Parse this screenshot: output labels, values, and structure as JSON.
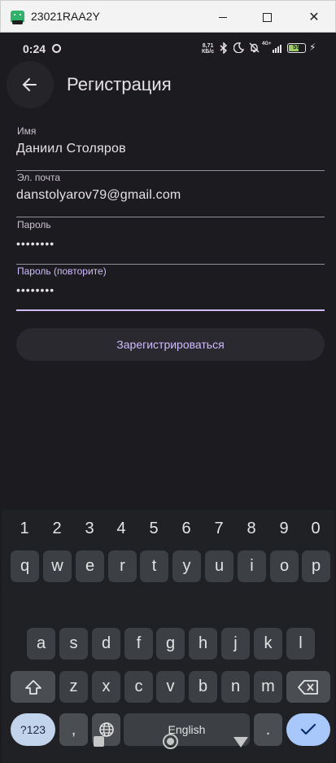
{
  "window": {
    "title": "23021RAA2Y",
    "close_glyph": "✕"
  },
  "status_bar": {
    "time": "0:24",
    "net_speed_value": "8,71",
    "net_speed_unit": "КБ/с",
    "network": "4G+",
    "battery": "59",
    "icons": [
      "bluetooth-icon",
      "moon-icon",
      "mute-icon",
      "signal-icon",
      "battery-icon",
      "charging-icon"
    ]
  },
  "app_bar": {
    "title": "Регистрация"
  },
  "form": {
    "name_label": "Имя",
    "name_value": "Даниил Столяров",
    "email_label": "Эл. почта",
    "email_value": "danstolyarov79@gmail.com",
    "password_label": "Пароль",
    "password_value": "••••••••",
    "password_repeat_label": "Пароль (повторите)",
    "password_repeat_value": "••••••••",
    "submit_label": "Зарегистрироваться"
  },
  "keyboard": {
    "numbers": [
      "1",
      "2",
      "3",
      "4",
      "5",
      "6",
      "7",
      "8",
      "9",
      "0"
    ],
    "row1": [
      "q",
      "w",
      "e",
      "r",
      "t",
      "y",
      "u",
      "i",
      "o",
      "p"
    ],
    "row2": [
      "a",
      "s",
      "d",
      "f",
      "g",
      "h",
      "j",
      "k",
      "l"
    ],
    "row3": [
      "z",
      "x",
      "c",
      "v",
      "b",
      "n",
      "m"
    ],
    "symbols_label": "?123",
    "comma": ",",
    "space_label": "English",
    "period": "."
  },
  "colors": {
    "accent": "#d0bcff",
    "background": "#1c1b1f",
    "enter_key": "#a8c7fa"
  }
}
